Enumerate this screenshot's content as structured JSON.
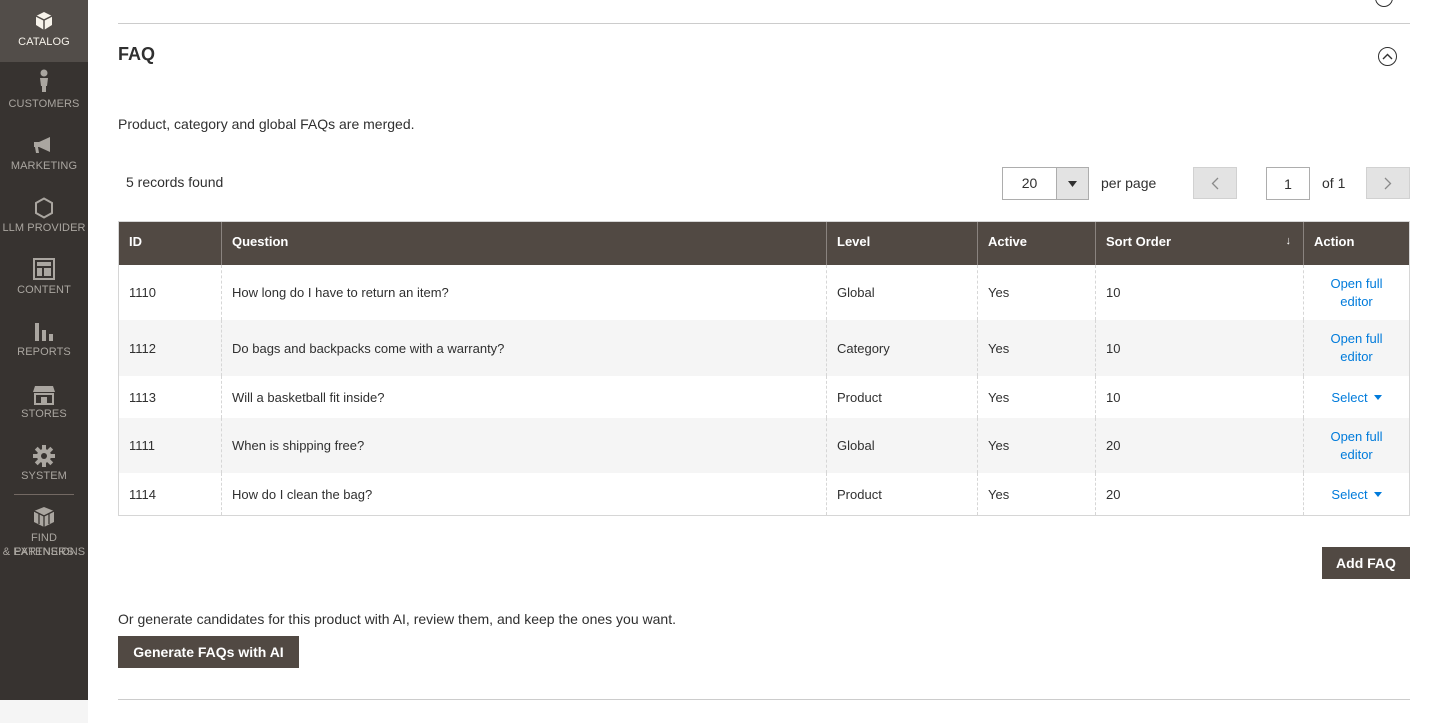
{
  "sidebar": {
    "items": [
      {
        "label": "CATALOG",
        "icon": "cube-icon",
        "active": true
      },
      {
        "label": "CUSTOMERS",
        "icon": "person-icon"
      },
      {
        "label": "MARKETING",
        "icon": "megaphone-icon"
      },
      {
        "label": "LLM PROVIDER",
        "icon": "hexagon-icon"
      },
      {
        "label": "CONTENT",
        "icon": "layout-icon"
      },
      {
        "label": "REPORTS",
        "icon": "bar-chart-icon"
      },
      {
        "label": "STORES",
        "icon": "storefront-icon"
      },
      {
        "label": "SYSTEM",
        "icon": "gear-icon"
      }
    ],
    "partners": {
      "line1": "FIND PARTNERS",
      "line2": "& EXTENSIONS",
      "icon": "boxes-icon"
    }
  },
  "section": {
    "title": "FAQ",
    "intro": "Product, category and global FAQs are merged."
  },
  "grid": {
    "records": "5 records found",
    "per_page_value": "20",
    "per_page_label": "per page",
    "page_current": "1",
    "page_of": "of 1",
    "sort_indicator": "↓",
    "columns": {
      "id": "ID",
      "question": "Question",
      "level": "Level",
      "active": "Active",
      "sort_order": "Sort Order",
      "action": "Action"
    },
    "rows": [
      {
        "id": "1110",
        "question": "How long do I have to return an item?",
        "level": "Global",
        "active": "Yes",
        "sort": "10",
        "action": "Open full editor"
      },
      {
        "id": "1112",
        "question": "Do bags and backpacks come with a warranty?",
        "level": "Category",
        "active": "Yes",
        "sort": "10",
        "action": "Open full editor"
      },
      {
        "id": "1113",
        "question": "Will a basketball fit inside?",
        "level": "Product",
        "active": "Yes",
        "sort": "10",
        "action": "Select"
      },
      {
        "id": "1111",
        "question": "When is shipping free?",
        "level": "Global",
        "active": "Yes",
        "sort": "20",
        "action": "Open full editor"
      },
      {
        "id": "1114",
        "question": "How do I clean the bag?",
        "level": "Product",
        "active": "Yes",
        "sort": "20",
        "action": "Select"
      }
    ]
  },
  "actions": {
    "add_faq": "Add FAQ",
    "generate_text": "Or generate candidates for this product with AI, review them, and keep the ones you want.",
    "generate_button": "Generate FAQs with AI"
  },
  "colors": {
    "sidebar_bg": "#373330",
    "sidebar_active": "#524d49",
    "header_bg": "#514943",
    "link": "#007bdb"
  }
}
